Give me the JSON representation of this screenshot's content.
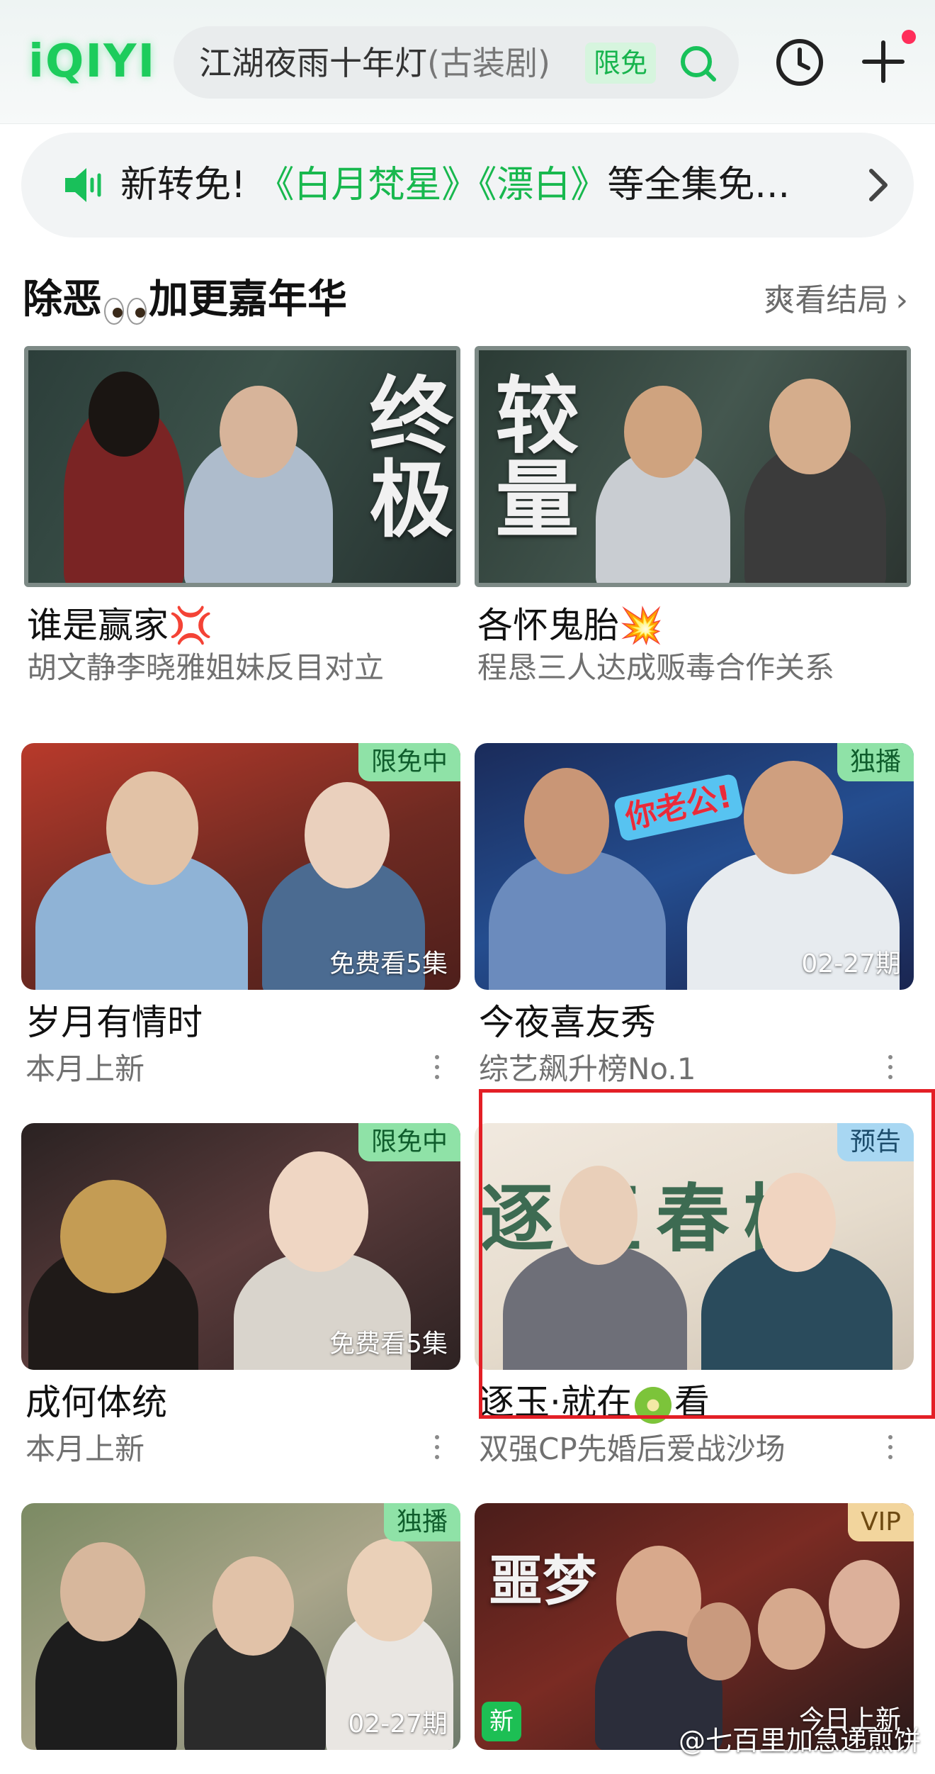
{
  "app": {
    "logo": "iQIYI"
  },
  "search": {
    "query": "江湖夜雨十年灯",
    "hint": "(古装剧)",
    "badge": "限免"
  },
  "notice": {
    "prefix": "新转免!",
    "title1": "《白月梵星》",
    "title2": "《漂白》",
    "suffix": "等全集免..."
  },
  "section": {
    "title_part1": "除恶",
    "title_part2": "加更嘉年华",
    "more": "爽看结局"
  },
  "cards": [
    {
      "title": "谁是赢家",
      "title_emoji": "💢",
      "subtitle": "胡文静李晓雅姐妹反目对立",
      "overlay_text": "终极"
    },
    {
      "title": "各怀鬼胎",
      "title_emoji": "💥",
      "subtitle": "程恳三人达成贩毒合作关系",
      "overlay_text": "较量"
    },
    {
      "title": "岁月有情时",
      "subtitle": "本月上新",
      "tag": "限免中",
      "bottom_text": "免费看5集"
    },
    {
      "title": "今夜喜友秀",
      "subtitle": "综艺飙升榜No.1",
      "tag": "独播",
      "bottom_text": "02-27期",
      "overlay_text": "你老公!"
    },
    {
      "title": "成何体统",
      "subtitle": "本月上新",
      "tag": "限免中",
      "bottom_text": "免费看5集"
    },
    {
      "title_pre": "逐玉·就在",
      "title_post": "看",
      "subtitle": "双强CP先婚后爱战沙场",
      "tag": "预告",
      "overlay_text": "逐玉春桃"
    },
    {
      "tag": "独播",
      "bottom_text": "02-27期"
    },
    {
      "tag": "VIP",
      "bottom_text": "今日上新",
      "new_badge": "新",
      "overlay_text": "噩梦"
    }
  ],
  "watermark": "@七百里加急递煎饼",
  "colors": {
    "brand_green": "#1dcc5c",
    "highlight_red": "#e31f26"
  }
}
